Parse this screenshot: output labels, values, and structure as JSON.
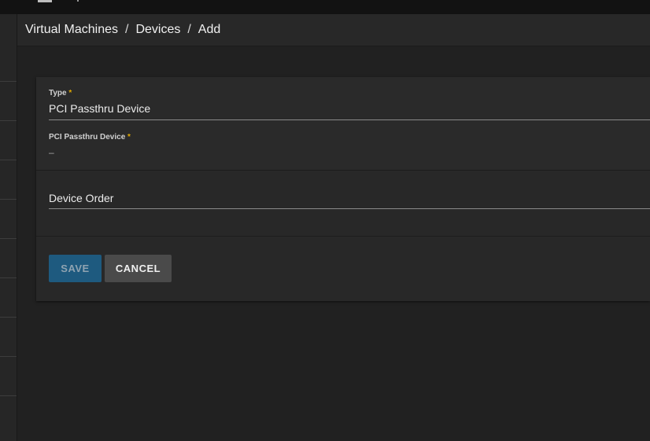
{
  "breadcrumb": {
    "items": [
      "Virtual Machines",
      "Devices",
      "Add"
    ],
    "separator": "/"
  },
  "form": {
    "type_label": "Type",
    "type_value": "PCI Passthru Device",
    "pci_label": "PCI Passthru Device",
    "pci_value": "–",
    "required_mark": "*",
    "order_label": "Device Order",
    "save_label": "SAVE",
    "cancel_label": "CANCEL"
  },
  "colors": {
    "accent": "#1e5a7f",
    "required": "#e0a800"
  }
}
